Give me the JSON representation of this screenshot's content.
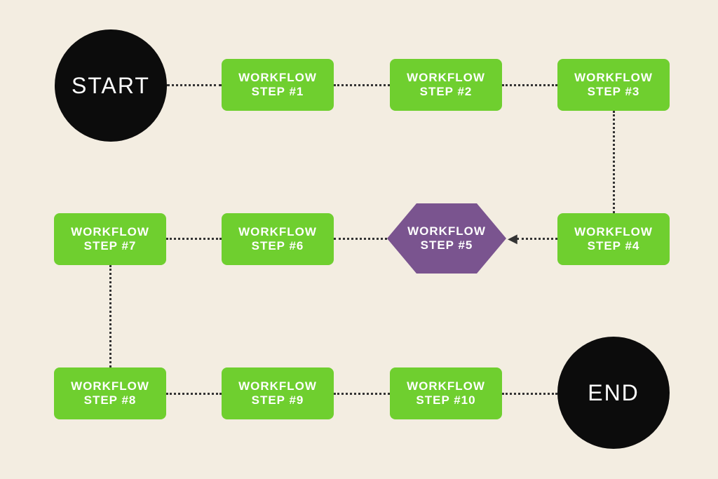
{
  "diagram": {
    "start_label": "START",
    "end_label": "END",
    "steps": {
      "s1": {
        "line1": "WORKFLOW",
        "line2": "STEP #1"
      },
      "s2": {
        "line1": "WORKFLOW",
        "line2": "STEP #2"
      },
      "s3": {
        "line1": "WORKFLOW",
        "line2": "STEP #3"
      },
      "s4": {
        "line1": "WORKFLOW",
        "line2": "STEP #4"
      },
      "s5": {
        "line1": "WORKFLOW",
        "line2": "STEP #5"
      },
      "s6": {
        "line1": "WORKFLOW",
        "line2": "STEP #6"
      },
      "s7": {
        "line1": "WORKFLOW",
        "line2": "STEP #7"
      },
      "s8": {
        "line1": "WORKFLOW",
        "line2": "STEP #8"
      },
      "s9": {
        "line1": "WORKFLOW",
        "line2": "STEP #9"
      },
      "s10": {
        "line1": "WORKFLOW",
        "line2": "STEP #10"
      }
    },
    "colors": {
      "background": "#f3ede1",
      "circle": "#0c0c0c",
      "rect": "#6fcf2f",
      "hex": "#7a548f",
      "connector": "#333333"
    },
    "flow_order": [
      "START",
      "STEP #1",
      "STEP #2",
      "STEP #3",
      "STEP #4",
      "STEP #5",
      "STEP #6",
      "STEP #7",
      "STEP #8",
      "STEP #9",
      "STEP #10",
      "END"
    ]
  }
}
